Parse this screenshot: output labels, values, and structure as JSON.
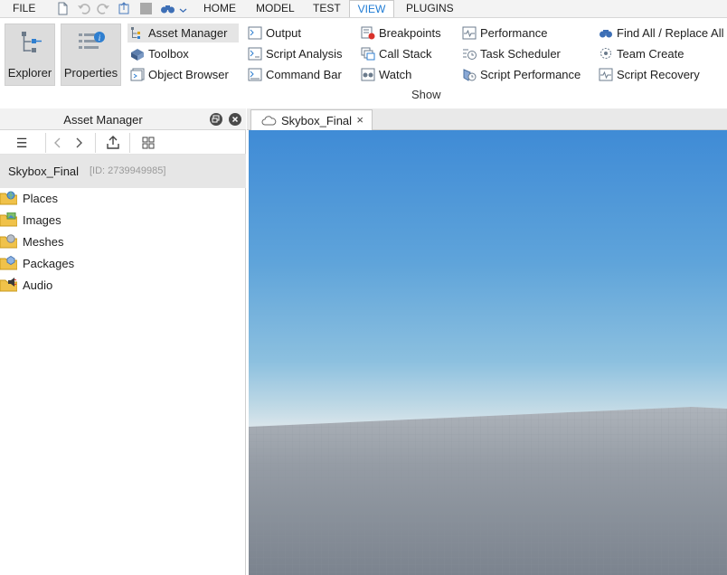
{
  "menubar": {
    "file_label": "FILE",
    "tabs": [
      {
        "label": "HOME"
      },
      {
        "label": "MODEL"
      },
      {
        "label": "TEST"
      },
      {
        "label": "VIEW"
      },
      {
        "label": "PLUGINS"
      }
    ],
    "active_tab": "VIEW",
    "accent_color": "#1e7bd4"
  },
  "ribbon": {
    "big_buttons": [
      {
        "label": "Explorer",
        "icon": "explorer-icon"
      },
      {
        "label": "Properties",
        "icon": "properties-icon"
      }
    ],
    "items": [
      {
        "label": "Asset Manager",
        "icon": "asset-manager-icon",
        "selected": true
      },
      {
        "label": "Toolbox",
        "icon": "toolbox-icon"
      },
      {
        "label": "Object Browser",
        "icon": "object-browser-icon"
      },
      {
        "label": "Output",
        "icon": "output-icon"
      },
      {
        "label": "Script Analysis",
        "icon": "script-analysis-icon"
      },
      {
        "label": "Command Bar",
        "icon": "command-bar-icon"
      },
      {
        "label": "Breakpoints",
        "icon": "breakpoints-icon"
      },
      {
        "label": "Call Stack",
        "icon": "call-stack-icon"
      },
      {
        "label": "Watch",
        "icon": "watch-icon"
      },
      {
        "label": "Performance",
        "icon": "performance-icon"
      },
      {
        "label": "Task Scheduler",
        "icon": "task-scheduler-icon"
      },
      {
        "label": "Script Performance",
        "icon": "script-performance-icon"
      },
      {
        "label": "Find All / Replace All",
        "icon": "find-replace-icon"
      },
      {
        "label": "Team Create",
        "icon": "team-create-icon"
      },
      {
        "label": "Script Recovery",
        "icon": "script-recovery-icon"
      }
    ],
    "group_label": "Show"
  },
  "asset_manager": {
    "title": "Asset Manager",
    "place_name": "Skybox_Final",
    "place_id": "[ID: 2739949985]",
    "folders": [
      {
        "label": "Places",
        "icon": "places-folder-icon"
      },
      {
        "label": "Images",
        "icon": "images-folder-icon"
      },
      {
        "label": "Meshes",
        "icon": "meshes-folder-icon"
      },
      {
        "label": "Packages",
        "icon": "packages-folder-icon"
      },
      {
        "label": "Audio",
        "icon": "audio-folder-icon"
      }
    ]
  },
  "editor": {
    "tab_label": "Skybox_Final",
    "close_glyph": "×"
  },
  "colors": {
    "sky_top": "#3f8bd6",
    "sky_horizon": "#e8ecef",
    "ground": "#8a929c",
    "selection": "#e5e5e5"
  }
}
